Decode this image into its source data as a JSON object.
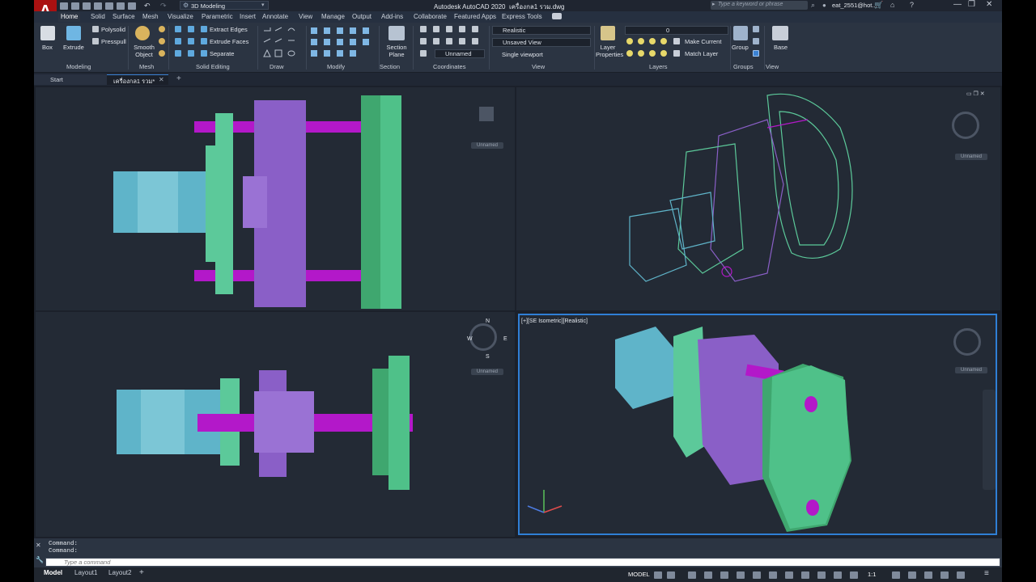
{
  "app": {
    "logo": "A",
    "title": "Autodesk AutoCAD 2020",
    "filename": "เครื่องกล1 รวม.dwg",
    "workspace": "3D Modeling",
    "search_placeholder": "Type a keyword or phrase",
    "user": "eat_2551@hot..."
  },
  "ribbon_tabs": [
    "Home",
    "Solid",
    "Surface",
    "Mesh",
    "Visualize",
    "Parametric",
    "Insert",
    "Annotate",
    "View",
    "Manage",
    "Output",
    "Add-ins",
    "Collaborate",
    "Featured Apps",
    "Express Tools"
  ],
  "ribbon": {
    "modeling": {
      "box": "Box",
      "extrude": "Extrude",
      "polysolid": "Polysolid",
      "presspull": "Presspull",
      "title": "Modeling"
    },
    "mesh": {
      "smooth_object": "Smooth Object",
      "title": "Mesh"
    },
    "solid_editing": {
      "extract_edges": "Extract Edges",
      "extrude_faces": "Extrude Faces",
      "separate": "Separate",
      "title": "Solid Editing"
    },
    "draw": {
      "title": "Draw"
    },
    "modify": {
      "title": "Modify"
    },
    "section": {
      "section_plane": "Section Plane",
      "title": "Section"
    },
    "coordinates": {
      "ucs": "Unnamed",
      "title": "Coordinates"
    },
    "view": {
      "visual_style": "Realistic",
      "saved_view": "Unsaved View",
      "viewport_config": "Single viewport",
      "title": "View"
    },
    "layers": {
      "layer_properties": "Layer Properties",
      "current_layer": "0",
      "make_current": "Make Current",
      "match_layer": "Match Layer",
      "title": "Layers"
    },
    "groups": {
      "group": "Group",
      "title": "Groups"
    },
    "base": {
      "base": "Base",
      "title": "View"
    }
  },
  "doc_tabs": [
    "Start",
    "เครื่องกล1 รวม*"
  ],
  "viewports": {
    "active_label": "[+][SE Isometric][Realistic]",
    "unnamed_label": "Unnamed",
    "compass": {
      "n": "N",
      "s": "S",
      "e": "E",
      "w": "W"
    }
  },
  "command": {
    "history": [
      "Command:",
      "Command:"
    ],
    "placeholder": "Type a command"
  },
  "status": {
    "layout_tabs": [
      "Model",
      "Layout1",
      "Layout2"
    ],
    "add_layout": "+",
    "model_label": "MODEL",
    "scale": "1:1"
  },
  "colors": {
    "cyan_part": "#5fb4c9",
    "mint_part": "#5cc99a",
    "purple_part": "#8a5fc7",
    "magenta_part": "#b318c9",
    "green_part": "#3fa76f",
    "active_border": "#2f7fd6"
  }
}
